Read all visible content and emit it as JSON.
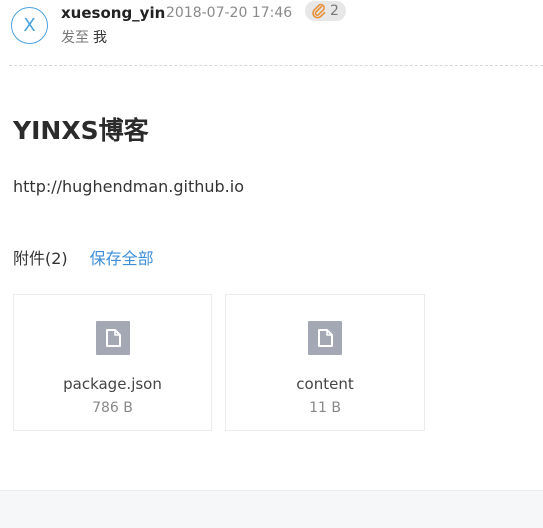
{
  "message": {
    "sender_initial": "X",
    "sender_name": "xuesong_yin",
    "date": "2018-07-20 17:46",
    "attachment_count": "2",
    "sent_to_label": "发至",
    "sent_to": "我"
  },
  "body": {
    "title": "YINXS博客",
    "link_text": "http://hughendman.github.io"
  },
  "attachments": {
    "header_label": "附件(2)",
    "save_all_label": "保存全部",
    "items": [
      {
        "name": "package.json",
        "size": "786 B"
      },
      {
        "name": "content",
        "size": "11 B"
      }
    ]
  },
  "icons": {
    "avatar": "avatar-initial",
    "attachment_badge": "paperclip-icon",
    "file": "file-icon"
  },
  "colors": {
    "accent": "#3f8fd8",
    "avatar_border": "#4aa3e0",
    "paperclip": "#e8903a",
    "file_icon_bg": "#a3a8b4"
  }
}
